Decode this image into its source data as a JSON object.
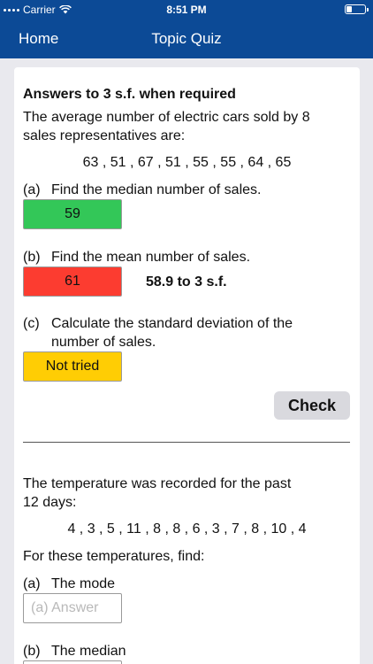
{
  "status": {
    "carrier": "Carrier",
    "time": "8:51 PM"
  },
  "nav": {
    "home": "Home",
    "title": "Topic Quiz"
  },
  "q1": {
    "header": "Answers to 3 s.f. when required",
    "prompt_line1": "The average number of electric cars sold by 8",
    "prompt_line2": "sales representatives are:",
    "data": "63 , 51 , 67 , 51 , 55 , 55 , 64 , 65",
    "part_a": {
      "label": "(a)",
      "text": "Find the median number of sales.",
      "answer": "59"
    },
    "part_b": {
      "label": "(b)",
      "text": "Find the mean number of sales.",
      "answer": "61",
      "feedback": "58.9 to 3 s.f."
    },
    "part_c": {
      "label": "(c)",
      "text_line1": "Calculate the standard deviation of the",
      "text_line2": "number of sales.",
      "answer": "Not tried"
    },
    "check_label": "Check"
  },
  "q2": {
    "prompt_line1": "The temperature was recorded for the past",
    "prompt_line2": "12 days:",
    "data": "4 , 3 , 5 , 11 , 8 , 8 , 6 , 3 , 7 , 8 , 10 , 4",
    "instruction": "For these temperatures, find:",
    "part_a": {
      "label": "(a)",
      "text": "The mode",
      "placeholder": "(a) Answer"
    },
    "part_b": {
      "label": "(b)",
      "text": "The median"
    }
  },
  "colors": {
    "nav": "#0c4a96",
    "correct": "#33c758",
    "wrong": "#fc3c30",
    "not_tried": "#ffcd04"
  }
}
